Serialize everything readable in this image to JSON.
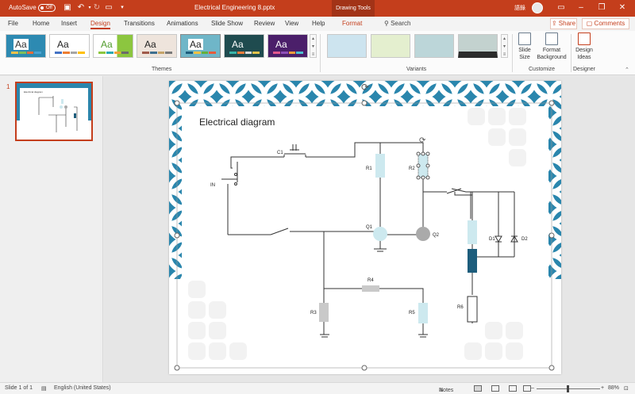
{
  "titlebar": {
    "autosave_label": "AutoSave",
    "autosave_state": "Off",
    "doc_title": "Electrical Engineering  8.pptx",
    "context_tab": "Drawing Tools",
    "user": "語錄"
  },
  "tabs": [
    "File",
    "Home",
    "Insert",
    "Design",
    "Transitions",
    "Animations",
    "Slide Show",
    "Review",
    "View",
    "Help"
  ],
  "active_tab": "Design",
  "format_tab": "Format",
  "search_label": "Search",
  "share_label": "Share",
  "comments_label": "Comments",
  "ribbon": {
    "themes_label": "Themes",
    "variants_label": "Variants",
    "customize_label": "Customize",
    "designer_label": "Designer",
    "slide_size": "Slide Size",
    "format_background": "Format Background",
    "design_ideas": "Design Ideas",
    "aa": "Aa"
  },
  "thumbs": {
    "slide_number": "1",
    "mini_title": "Electrical diagram"
  },
  "slide": {
    "title": "Electrical diagram",
    "labels": {
      "c1": "C1",
      "in": "IN",
      "r1": "R1",
      "r2": "R2",
      "q1": "Q1",
      "q2": "Q2",
      "d1": "D1",
      "d2": "D2",
      "r3": "R3",
      "r4": "R4",
      "r5": "R5",
      "r6": "R6"
    }
  },
  "statusbar": {
    "slide_info": "Slide 1 of 1",
    "language": "English (United States)",
    "notes": "Notes",
    "zoom": "88%"
  },
  "colors": {
    "accent": "#c43e1c",
    "pattern_blue": "#2a86ad",
    "resistor_light": "#cde9ef",
    "resistor_dark": "#1d5d7c",
    "node_grey": "#aaaaaa"
  }
}
